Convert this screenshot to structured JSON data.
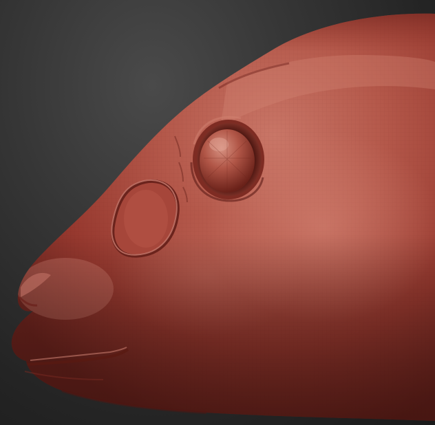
{
  "scene": {
    "subject": "sculpted-creature-head",
    "view": "side-profile",
    "colors": {
      "background_top": "#4a4a4a",
      "background_bottom": "#1a1a1a",
      "clay_light": "#c46a5c",
      "clay_mid": "#a8483c",
      "clay_dark": "#6e2620",
      "clay_shadow": "#4a1713",
      "eye_ring": "#8a332a",
      "eye_ball": "#b85b4d"
    }
  }
}
